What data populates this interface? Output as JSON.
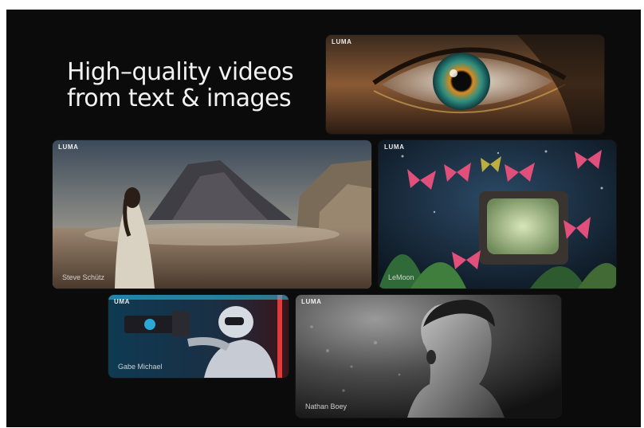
{
  "headline": {
    "line1": "High–quality videos",
    "line2": "from text & images"
  },
  "cards": [
    {
      "id": "eye",
      "brand": "LUMA",
      "credit": "",
      "icon": "eye-image"
    },
    {
      "id": "desert",
      "brand": "LUMA",
      "credit": "Steve Schütz",
      "icon": "desert-figure-image"
    },
    {
      "id": "butterflies",
      "brand": "LUMA",
      "credit": "LeMoon",
      "icon": "butterflies-tv-image"
    },
    {
      "id": "robot",
      "brand": "UMA",
      "credit": "Gabe Michael",
      "icon": "robot-camera-image"
    },
    {
      "id": "portrait",
      "brand": "LUMA",
      "credit": "Nathan Boey",
      "icon": "underwater-portrait-image"
    }
  ],
  "colors": {
    "background": "#0b0b0c",
    "text": "#f2f2f2",
    "page_border": "#ffffff"
  }
}
